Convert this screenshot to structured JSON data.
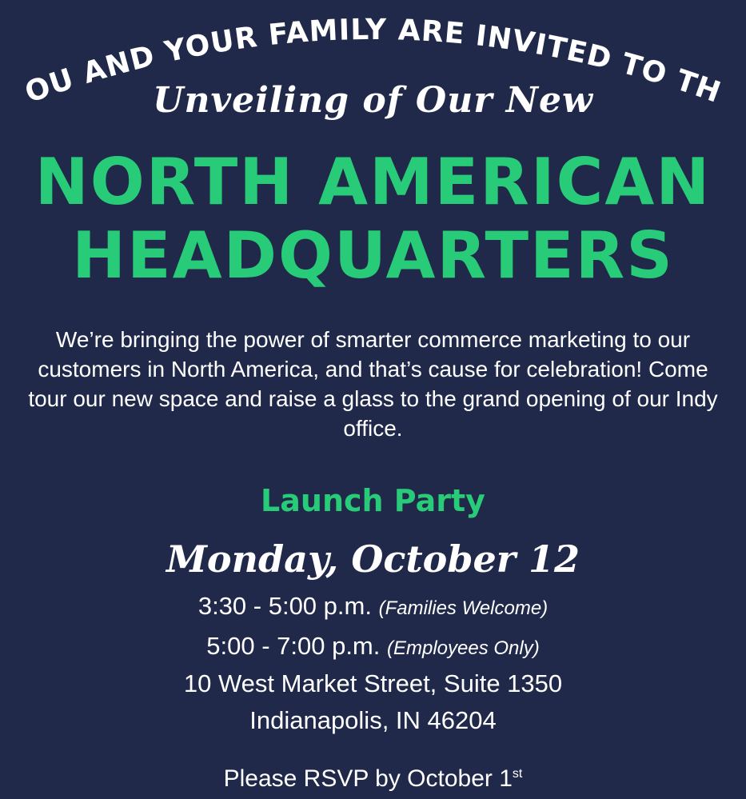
{
  "invite": {
    "arc_heading": "YOU AND YOUR FAMILY ARE INVITED TO THE",
    "subtitle": "Unveiling of Our New",
    "headline_line1": "NORTH AMERICAN",
    "headline_line2": "HEADQUARTERS",
    "intro": "We’re bringing the power of smarter commerce marketing to our customers in North America, and that’s cause for celebration! Come tour our new space and raise a glass to the grand opening of our Indy office.",
    "event_title": "Launch Party",
    "date": "Monday, October 12",
    "session1_time": "3:30 - 5:00 p.m.",
    "session1_note": "(Families Welcome)",
    "session2_time": "5:00 - 7:00 p.m.",
    "session2_note": "(Employees Only)",
    "address_line1": "10 West Market Street, Suite 1350",
    "address_line2": "Indianapolis, IN 46204",
    "rsvp_text": "Please RSVP by October 1",
    "rsvp_suffix": "st"
  },
  "colors": {
    "background": "#20294a",
    "accent_green": "#28cb78",
    "text": "#ffffff"
  }
}
